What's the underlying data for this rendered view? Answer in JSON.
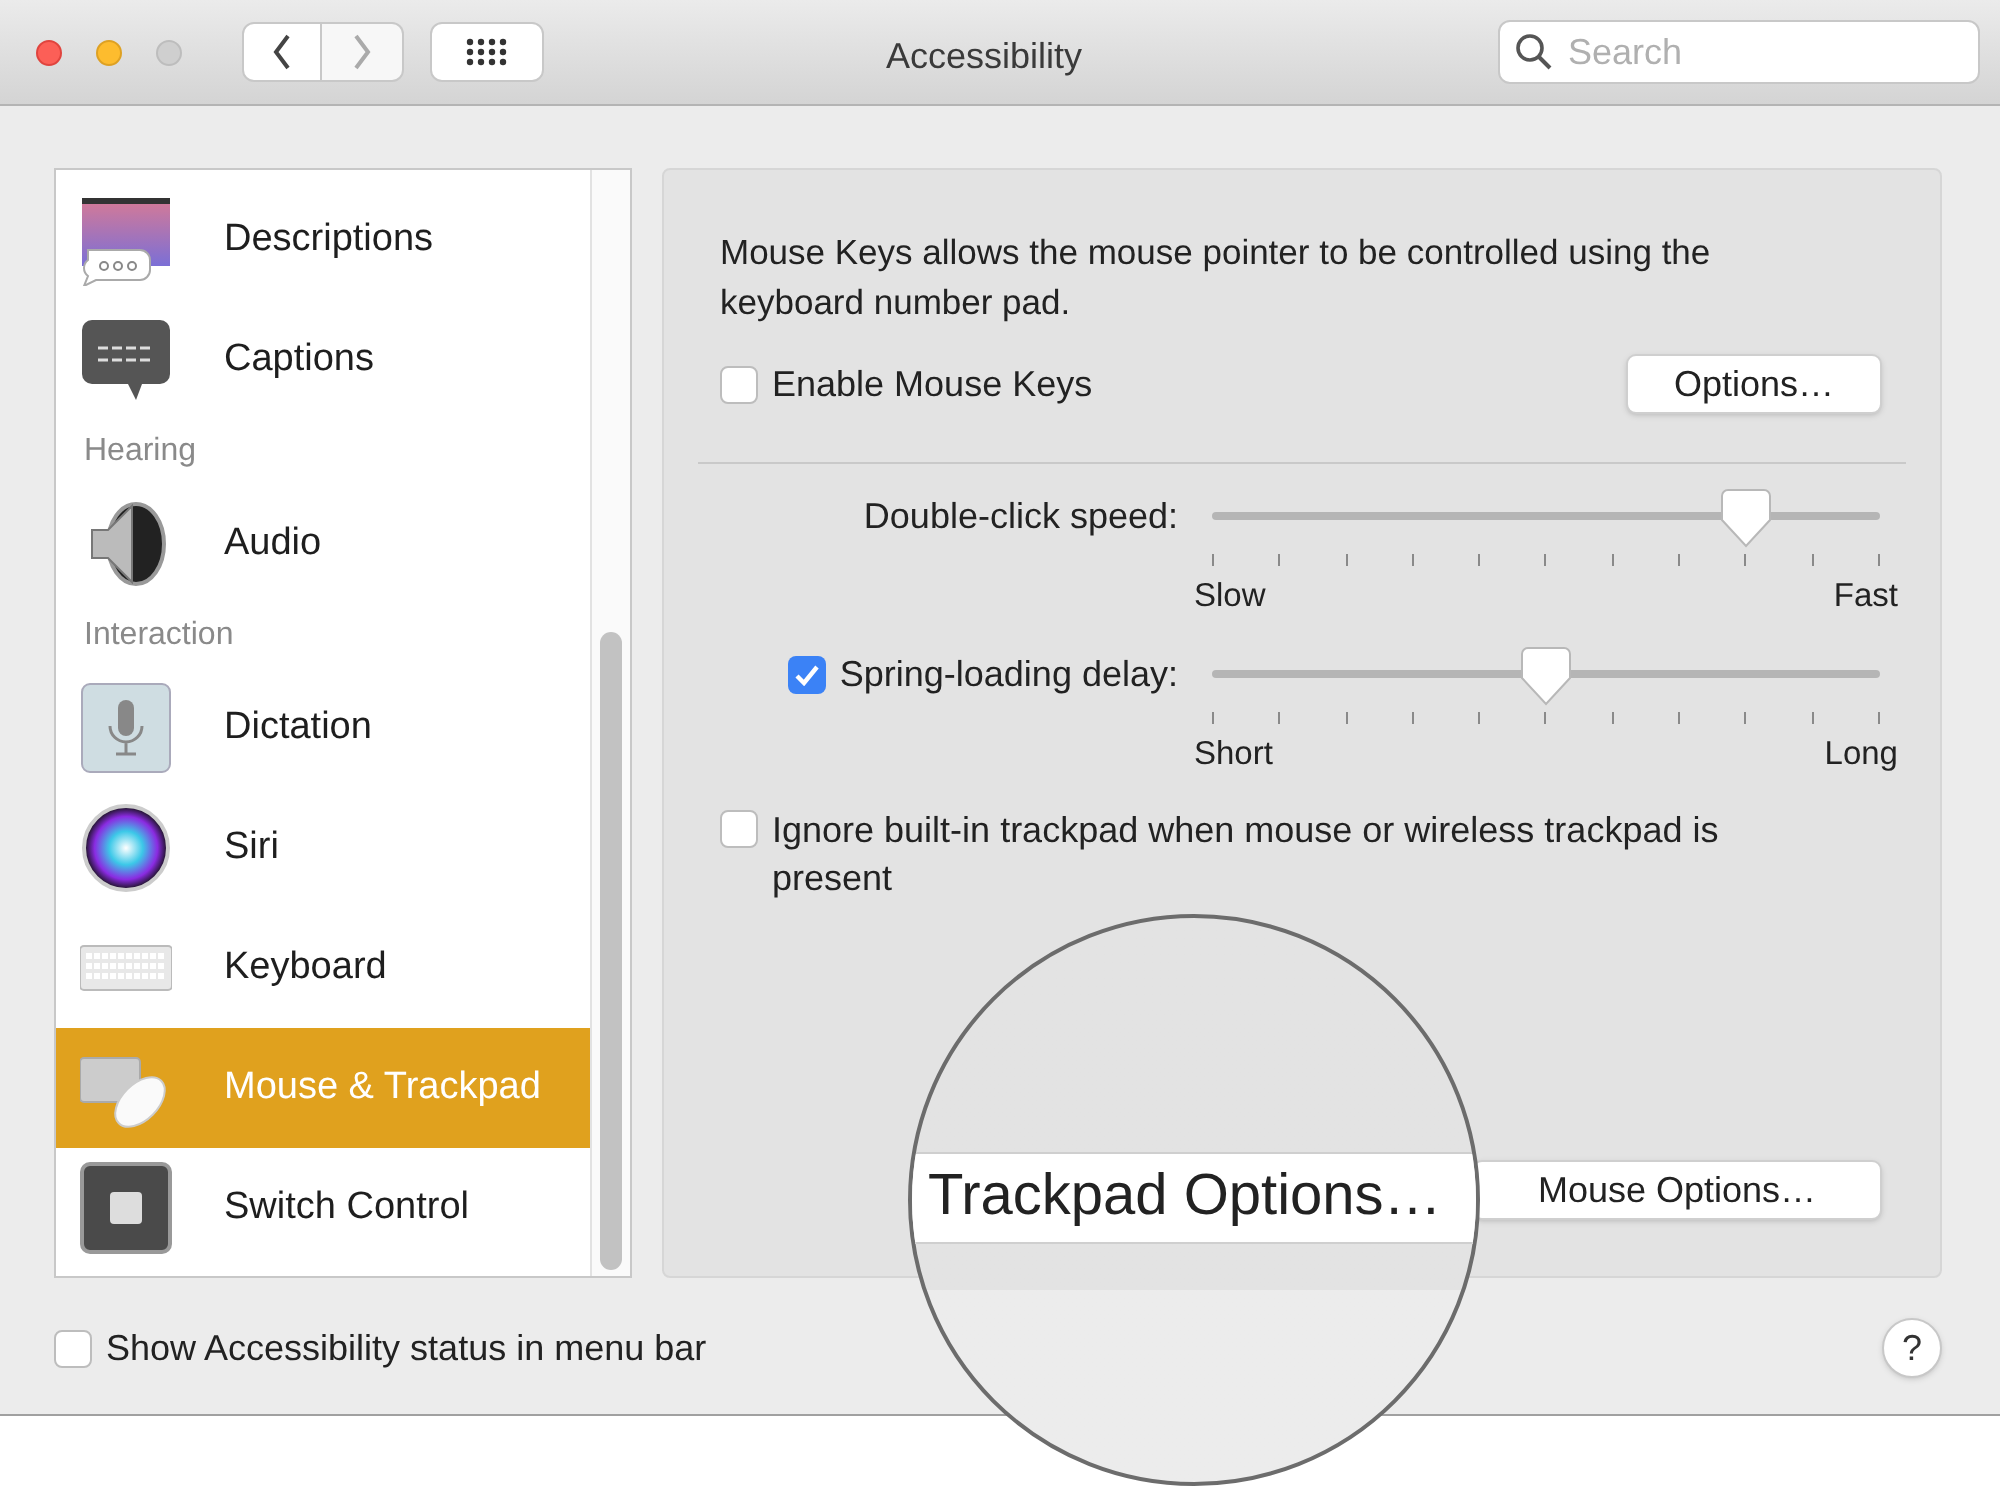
{
  "window": {
    "title": "Accessibility"
  },
  "search": {
    "placeholder": "Search"
  },
  "sidebar": {
    "items": [
      {
        "kind": "item",
        "label": "Descriptions",
        "selected": false
      },
      {
        "kind": "item",
        "label": "Captions",
        "selected": false
      },
      {
        "kind": "header",
        "label": "Hearing"
      },
      {
        "kind": "item",
        "label": "Audio",
        "selected": false
      },
      {
        "kind": "header",
        "label": "Interaction"
      },
      {
        "kind": "item",
        "label": "Dictation",
        "selected": false
      },
      {
        "kind": "item",
        "label": "Siri",
        "selected": false
      },
      {
        "kind": "item",
        "label": "Keyboard",
        "selected": false
      },
      {
        "kind": "item",
        "label": "Mouse & Trackpad",
        "selected": true
      },
      {
        "kind": "item",
        "label": "Switch Control",
        "selected": false
      }
    ]
  },
  "mouse_keys": {
    "description": "Mouse Keys allows the mouse pointer to be controlled using the keyboard number pad.",
    "enable": {
      "label": "Enable Mouse Keys",
      "checked": false
    },
    "options_button": "Options…"
  },
  "sliders": [
    {
      "kind": "plain",
      "label": "Double-click speed:",
      "level": 0.8,
      "min_label": "Slow",
      "max_label": "Fast"
    },
    {
      "kind": "checkbox",
      "label": "Spring-loading delay:",
      "checked": true,
      "level": 0.5,
      "min_label": "Short",
      "max_label": "Long"
    }
  ],
  "ignore_trackpad": {
    "label": "Ignore built-in trackpad when mouse or wireless trackpad is present",
    "checked": false
  },
  "buttons": {
    "trackpad_options": "Trackpad Options…",
    "mouse_options": "Mouse Options…"
  },
  "status_checkbox": {
    "label": "Show Accessibility status in menu bar",
    "checked": false
  },
  "help": "?"
}
